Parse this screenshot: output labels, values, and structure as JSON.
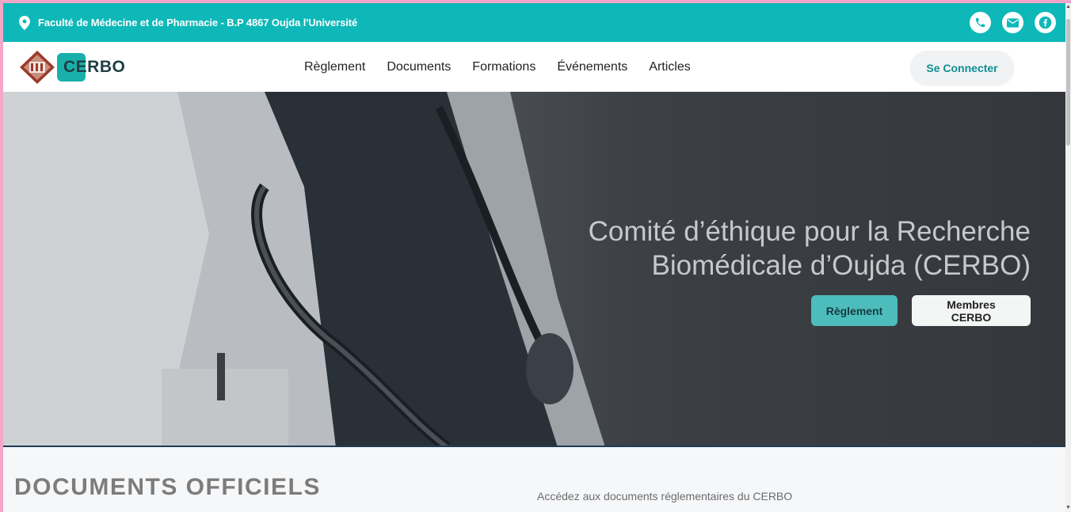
{
  "topbar": {
    "address": "Faculté de Médecine et de Pharmacie - B.P 4867 Oujda l'Université",
    "icons": [
      "location-pin-icon",
      "phone-icon",
      "email-icon",
      "facebook-icon"
    ]
  },
  "navbar": {
    "logo_text": "CERBO",
    "links": [
      "Règlement",
      "Documents",
      "Formations",
      "Événements",
      "Articles"
    ],
    "connect_label": "Se Connecter"
  },
  "hero": {
    "title_line1": "Comité d’éthique pour la Recherche",
    "title_line2": "Biomédicale d’Oujda (CERBO)",
    "btn_primary": "Règlement",
    "btn_secondary": "Membres CERBO"
  },
  "documents": {
    "title": "DOCUMENTS OFFICIELS",
    "subtitle": "Accédez aux documents réglementaires du CERBO"
  },
  "colors": {
    "accent": "#0fb8b8",
    "button_teal": "#4dbcbc",
    "logo_red": "#9b3b2a"
  }
}
